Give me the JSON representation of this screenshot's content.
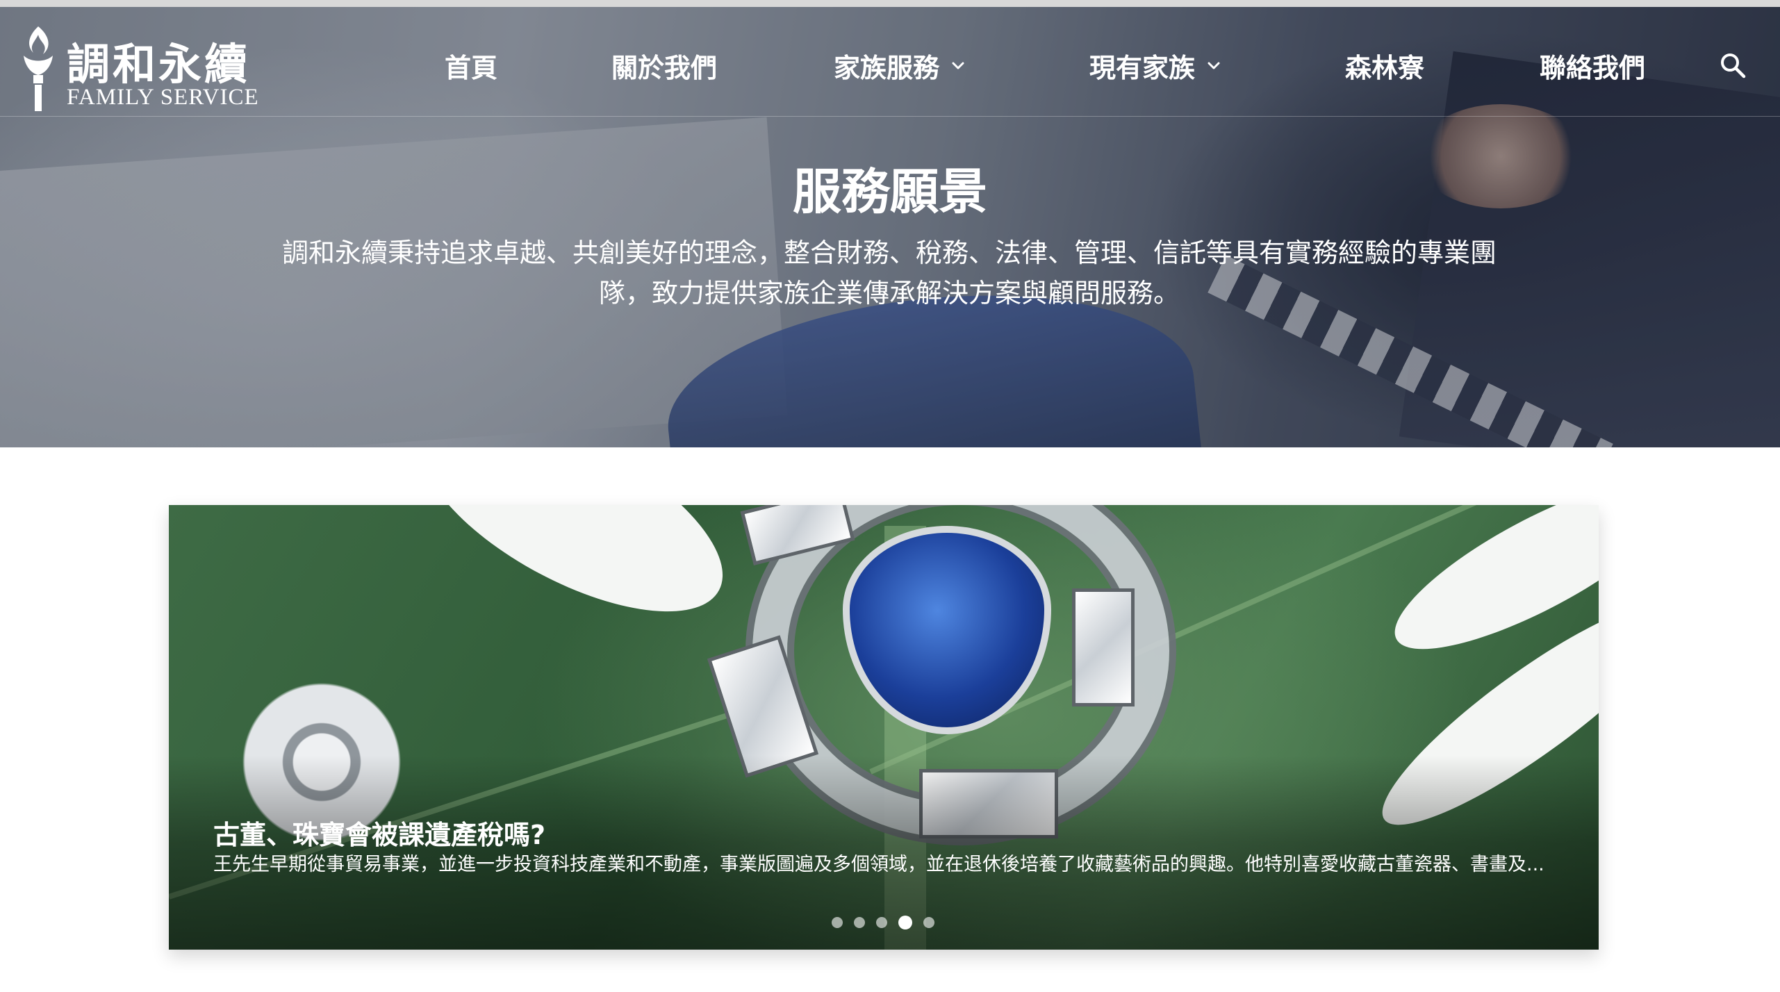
{
  "brand": {
    "name": "調和永續",
    "subtitle": "FAMILY SERVICE"
  },
  "nav": {
    "items": [
      {
        "label": "首頁",
        "has_dropdown": false
      },
      {
        "label": "關於我們",
        "has_dropdown": false
      },
      {
        "label": "家族服務",
        "has_dropdown": true
      },
      {
        "label": "現有家族",
        "has_dropdown": true
      },
      {
        "label": "森林寮",
        "has_dropdown": false
      },
      {
        "label": "聯絡我們",
        "has_dropdown": false
      }
    ],
    "search_icon": "search-icon"
  },
  "hero": {
    "title": "服務願景",
    "text": "調和永續秉持追求卓越、共創美好的理念，整合財務、稅務、法律、管理、信託等具有實務經驗的專業團隊，致力提供家族企業傳承解決方案與顧問服務。"
  },
  "carousel": {
    "title": "古董、珠寶會被課遺產稅嗎?",
    "text": "王先生早期從事貿易事業，並進一步投資科技產業和不動產，事業版圖遍及多個領域，並在退休後培養了收藏藝術品的興趣。他特別喜愛收藏古董瓷器、書畫及...",
    "slide_count": 5,
    "active_slide": 4
  },
  "colors": {
    "nav_text": "#ffffff",
    "page_background": "#ffffff",
    "carousel_leaf": "#3e6b45",
    "gem_blue": "#1b3f9a"
  }
}
